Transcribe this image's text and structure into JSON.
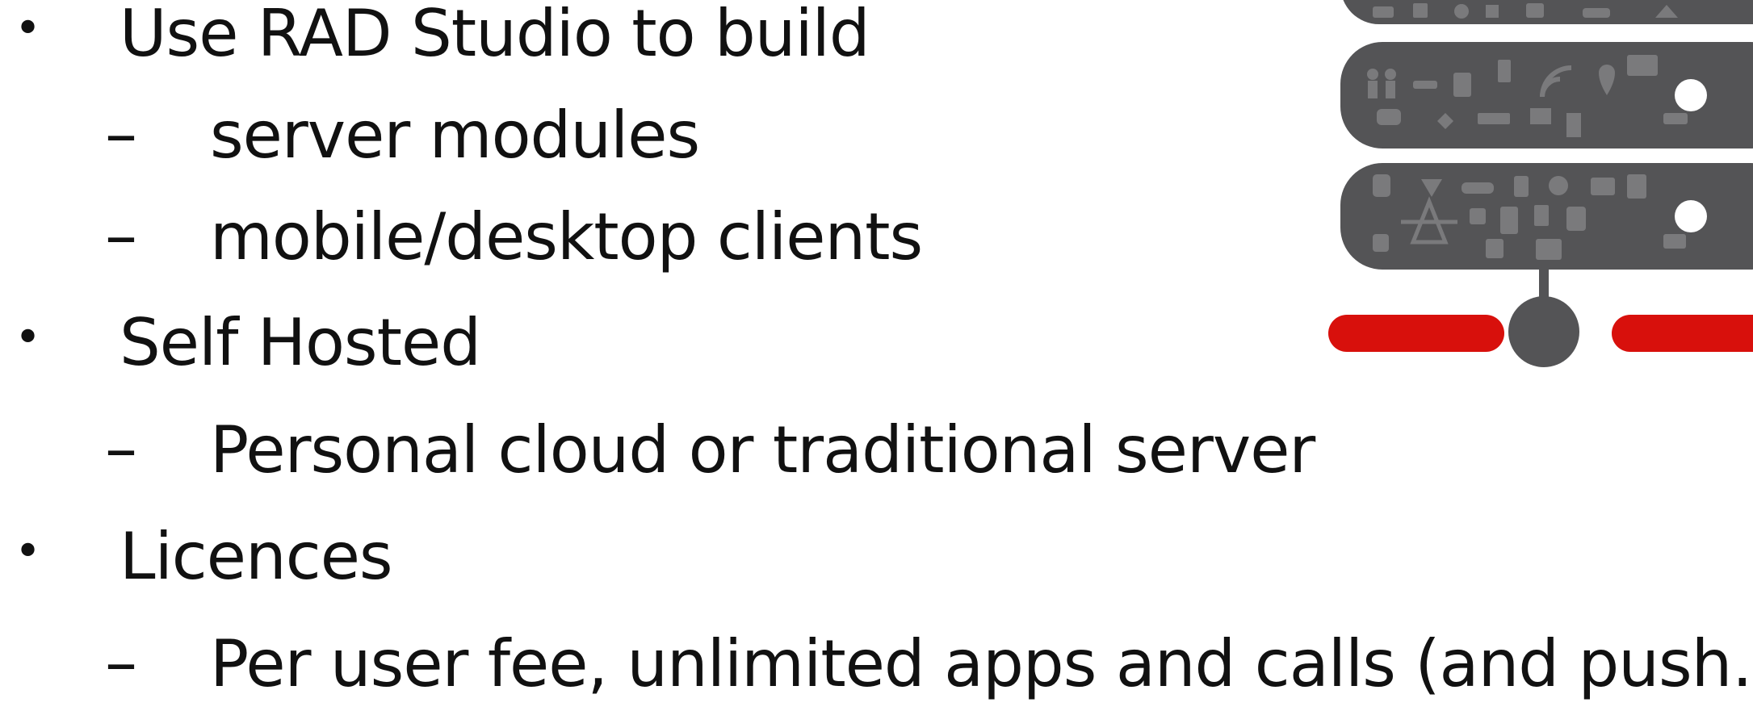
{
  "slide": {
    "bullets": [
      {
        "text": "Use RAD Studio to build",
        "subitems": [
          {
            "text": "server modules"
          },
          {
            "text": "mobile/desktop clients"
          }
        ]
      },
      {
        "text": "Self Hosted",
        "subitems": [
          {
            "text": "Personal cloud or traditional server"
          }
        ]
      },
      {
        "text": "Licences",
        "subitems": [
          {
            "text": "Per user fee, unlimited apps and calls (and push…)"
          }
        ]
      }
    ],
    "bullet_marker": "•",
    "sub_marker": "–"
  },
  "graphic": {
    "icon": "server-stack-icon",
    "colors": {
      "server_body": "#545456",
      "server_icons": "#7a7a7c",
      "network_bar": "#d8100c",
      "led": "#ffffff"
    }
  }
}
